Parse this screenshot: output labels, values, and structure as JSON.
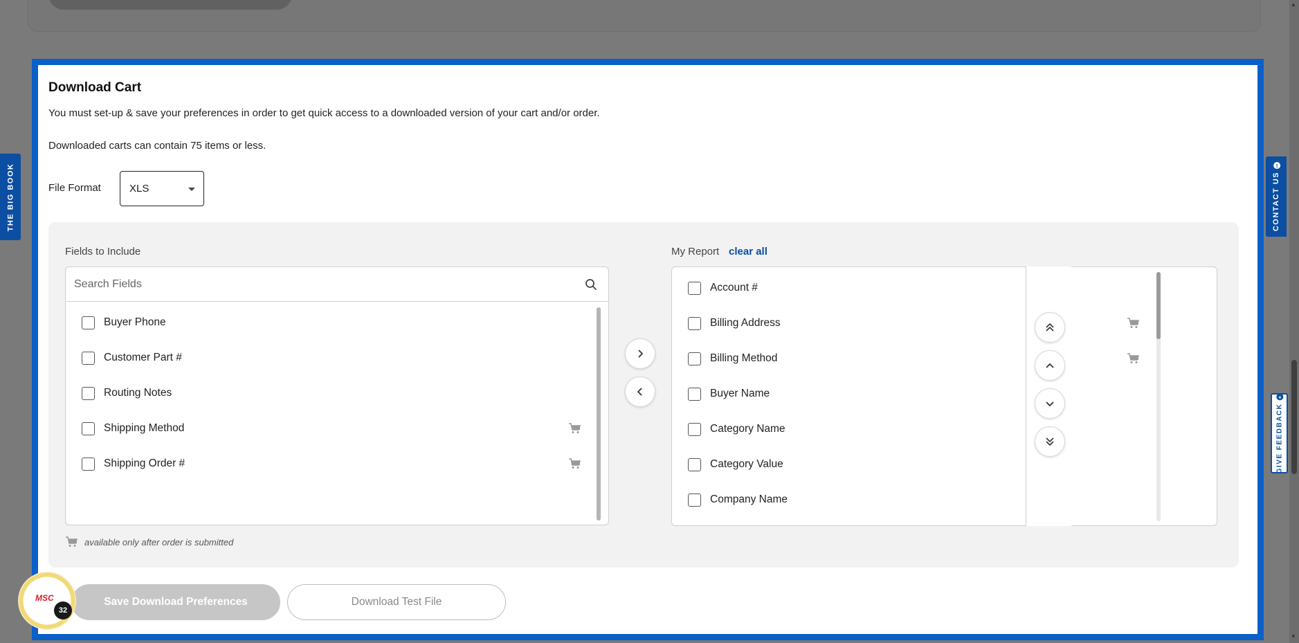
{
  "side_tabs": {
    "big_book": "THE BIG BOOK",
    "contact_us": "CONTACT US",
    "give_feedback": "GIVE FEEDBACK"
  },
  "modal": {
    "title": "Download Cart",
    "description_1": "You must set-up & save your preferences in order to get quick access to a downloaded version of your cart and/or order.",
    "description_2": "Downloaded carts can contain 75 items or less.",
    "file_format_label": "File Format",
    "file_format_value": "XLS",
    "fields_label": "Fields to Include",
    "search_placeholder": "Search Fields",
    "available_fields": [
      {
        "label": "Buyer Phone",
        "cart_only": false
      },
      {
        "label": "Customer Part #",
        "cart_only": false
      },
      {
        "label": "Routing Notes",
        "cart_only": false
      },
      {
        "label": "Shipping Method",
        "cart_only": true
      },
      {
        "label": "Shipping Order #",
        "cart_only": true
      }
    ],
    "report_label": "My Report",
    "clear_all": "clear all",
    "report_fields": [
      {
        "label": "Account #",
        "cart_only": false
      },
      {
        "label": "Billing Address",
        "cart_only": true
      },
      {
        "label": "Billing Method",
        "cart_only": true
      },
      {
        "label": "Buyer Name",
        "cart_only": false
      },
      {
        "label": "Category Name",
        "cart_only": false
      },
      {
        "label": "Category Value",
        "cart_only": false
      },
      {
        "label": "Company Name",
        "cart_only": false
      }
    ],
    "note": "available only after order is submitted",
    "save_button": "Save Download Preferences",
    "test_button": "Download Test File"
  },
  "msc_badge": {
    "logo": "MSC",
    "count": "32"
  },
  "colors": {
    "accent": "#0a5fc9",
    "brand_blue": "#0b4ea2",
    "msc_red": "#d81e2c",
    "overlay": "#7a7a7a"
  }
}
